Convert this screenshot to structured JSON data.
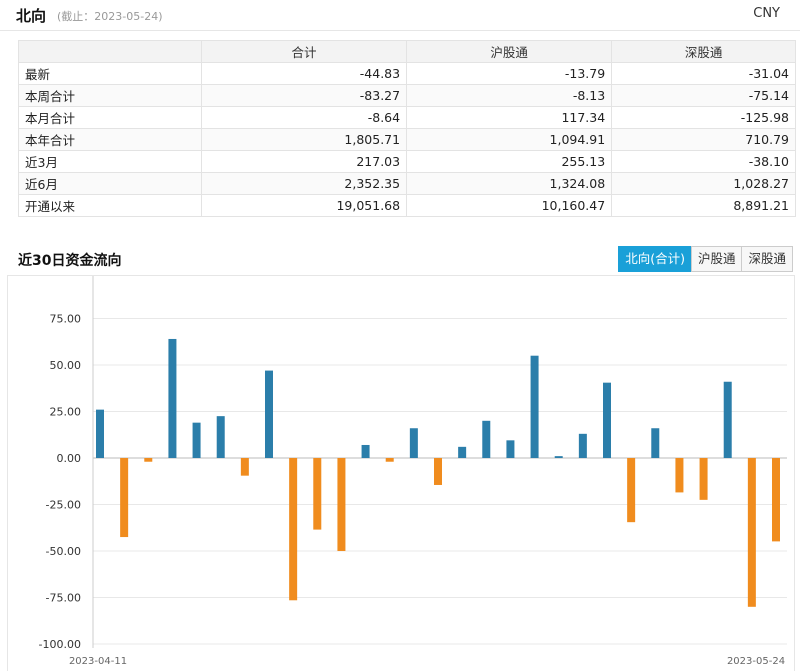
{
  "header": {
    "title": "北向",
    "subtitle": "(截止：2023-05-24)",
    "currency": "CNY"
  },
  "table": {
    "columns": [
      "",
      "合计",
      "沪股通",
      "深股通"
    ],
    "rows": [
      {
        "label": "最新",
        "total": "-44.83",
        "sh": "-13.79",
        "sz": "-31.04"
      },
      {
        "label": "本周合计",
        "total": "-83.27",
        "sh": "-8.13",
        "sz": "-75.14"
      },
      {
        "label": "本月合计",
        "total": "-8.64",
        "sh": "117.34",
        "sz": "-125.98"
      },
      {
        "label": "本年合计",
        "total": "1,805.71",
        "sh": "1,094.91",
        "sz": "710.79"
      },
      {
        "label": "近3月",
        "total": "217.03",
        "sh": "255.13",
        "sz": "-38.10"
      },
      {
        "label": "近6月",
        "total": "2,352.35",
        "sh": "1,324.08",
        "sz": "1,028.27"
      },
      {
        "label": "开通以来",
        "total": "19,051.68",
        "sh": "10,160.47",
        "sz": "8,891.21"
      }
    ]
  },
  "chart_section": {
    "title": "近30日资金流向",
    "tabs": [
      {
        "label": "北向(合计)",
        "active": true
      },
      {
        "label": "沪股通",
        "active": false
      },
      {
        "label": "深股通",
        "active": false
      }
    ]
  },
  "chart_data": {
    "type": "bar",
    "ylim": [
      -100,
      100
    ],
    "yticks": [
      100,
      75,
      50,
      25,
      0,
      -25,
      -50,
      -75,
      -100
    ],
    "ytick_labels": [
      "100.00",
      "75.00",
      "50.00",
      "25.00",
      "0.00",
      "-25.00",
      "-50.00",
      "-75.00",
      "-100.00"
    ],
    "x_first_label": "2023-04-11",
    "x_last_label": "2023-05-24",
    "values": [
      26,
      -42.5,
      -2,
      64,
      19,
      22.5,
      -9.5,
      47,
      -76.5,
      -38.5,
      -50,
      7,
      -2,
      16,
      -14.5,
      6,
      20,
      9.5,
      55,
      1,
      13,
      40.5,
      -34.5,
      16,
      -18.5,
      -22.5,
      41,
      -80,
      -44.83
    ],
    "colors": {
      "positive": "#2b7eaa",
      "negative": "#f08c1e"
    },
    "grid": true
  }
}
